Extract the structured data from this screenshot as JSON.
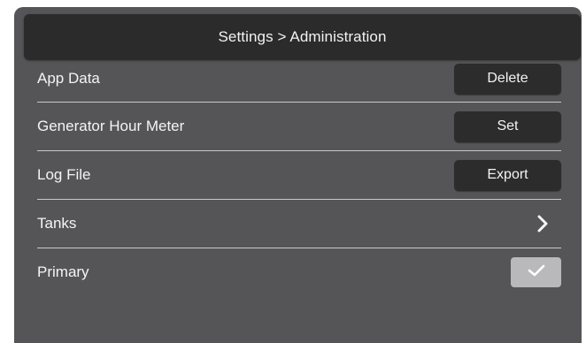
{
  "header": {
    "title": "Settings > Administration"
  },
  "rows": [
    {
      "label": "App Data",
      "control": "button",
      "button_label": "Delete"
    },
    {
      "label": "Generator Hour Meter",
      "control": "button",
      "button_label": "Set"
    },
    {
      "label": "Log File",
      "control": "button",
      "button_label": "Export"
    },
    {
      "label": "Tanks",
      "control": "chevron",
      "icon": "chevron-right-icon"
    },
    {
      "label": "Primary",
      "control": "checkbox",
      "checked": true,
      "icon": "check-icon"
    }
  ],
  "colors": {
    "background": "#555557",
    "header": "#2b2b2c",
    "button": "#2c2c2d",
    "checkbox": "#b9b9bb",
    "text": "#f4f4f4",
    "divider": "#c9c9cb"
  }
}
